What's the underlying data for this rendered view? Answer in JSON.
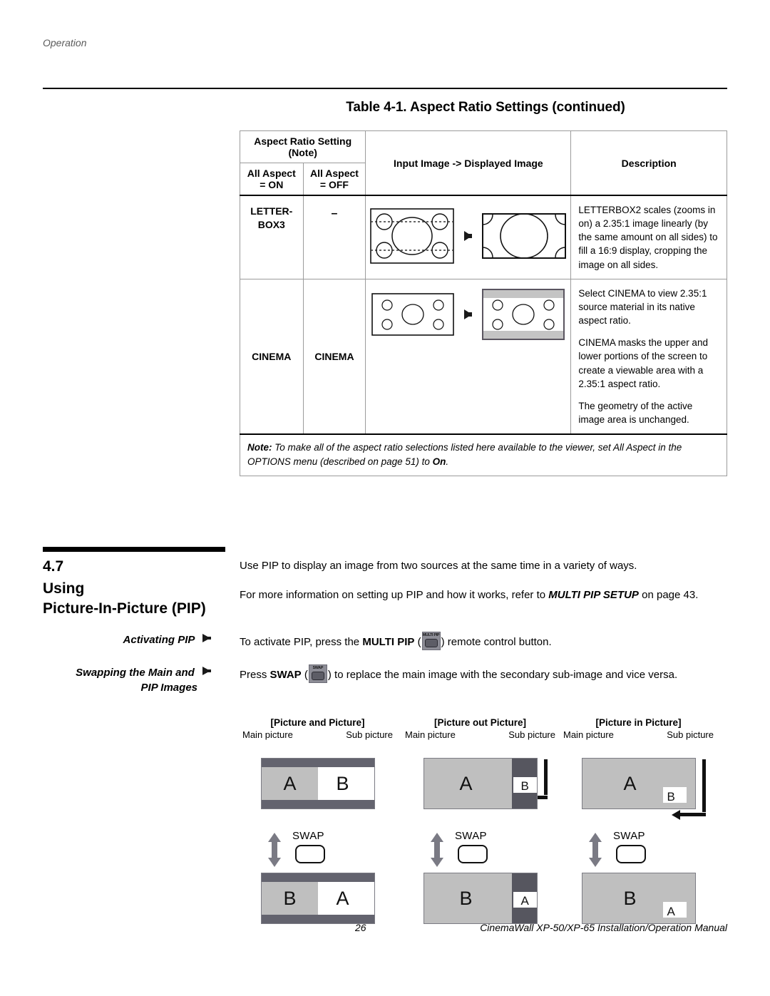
{
  "page": {
    "running_header": "Operation",
    "footer_page_number": "26",
    "footer_text": "CinemaWall XP-50/XP-65 Installation/Operation Manual"
  },
  "table": {
    "title": "Table 4-1. Aspect Ratio Settings (continued)",
    "headers": {
      "setting_group": "Aspect Ratio Setting",
      "setting_note": "(Note)",
      "all_aspect_on_line1": "All Aspect",
      "all_aspect_on_line2": "= ON",
      "all_aspect_off_line1": "All Aspect",
      "all_aspect_off_line2": "= OFF",
      "input_image": "Input Image -> Displayed Image",
      "description": "Description"
    },
    "rows": [
      {
        "on_label_line1": "LETTER-",
        "on_label_line2": "BOX3",
        "off_label": "–",
        "description": [
          "LETTERBOX2 scales (zooms in on) a 2.35:1 image linearly (by the same amount on all sides) to fill a 16:9 display, cropping the image on all sides."
        ]
      },
      {
        "on_label": "CINEMA",
        "off_label": "CINEMA",
        "description": [
          "Select CINEMA to view 2.35:1 source material in its native aspect ratio.",
          "CINEMA masks the upper and lower portions of the screen to create a viewable area with a 2.35:1 aspect ratio.",
          "The geometry of the active image area is unchanged."
        ]
      }
    ],
    "note": {
      "label": "Note:",
      "text_part1": " To make all of the aspect ratio selections listed here available to the viewer, set All Aspect in the OPTIONS menu (described on page 51) to ",
      "bold_end": "On",
      "period": "."
    }
  },
  "section": {
    "number": "4.7",
    "title_line1": "Using",
    "title_line2": "Picture-In-Picture (PIP)",
    "paragraph1": "Use PIP to display an image from two sources at the same time in a variety of ways.",
    "paragraph2_a": "For more information on setting up PIP and how it works, refer to ",
    "paragraph2_bold": "MULTI PIP SETUP",
    "paragraph2_b": " on page 43."
  },
  "subsections": [
    {
      "label": "Activating PIP",
      "body_a": "To activate PIP, press the ",
      "body_bold": "MULTI PIP",
      "button_label": "MULTI PIP",
      "body_b": " remote control button.",
      "open_paren": "(",
      "close_paren": ")"
    },
    {
      "label_line1": "Swapping the Main and",
      "label_line2": "PIP Images",
      "body_a": "Press ",
      "body_bold": "SWAP",
      "button_label": "SWAP",
      "body_b": " to replace the main image with the secondary sub-image and vice versa.",
      "open_paren": "(",
      "close_paren": ")"
    }
  ],
  "pip_diagrams": {
    "swap_label": "SWAP",
    "columns": [
      {
        "title": "[Picture and Picture]",
        "caption_main": "Main picture",
        "caption_sub": "Sub picture",
        "top_main_letter": "A",
        "top_sub_letter": "B",
        "bottom_main_letter": "B",
        "bottom_sub_letter": "A"
      },
      {
        "title": "[Picture out Picture]",
        "caption_main": "Main picture",
        "caption_sub": "Sub picture",
        "top_main_letter": "A",
        "top_sub_letter": "B",
        "bottom_main_letter": "B",
        "bottom_sub_letter": "A"
      },
      {
        "title": "[Picture in Picture]",
        "caption_main": "Main picture",
        "caption_sub": "Sub picture",
        "top_main_letter": "A",
        "top_sub_letter": "B",
        "bottom_main_letter": "B",
        "bottom_sub_letter": "A"
      }
    ]
  },
  "colors": {
    "screen_gray": "#bfbfbf",
    "bar_dark": "#63636e",
    "sub_panel_dark": "#56565f",
    "arrow_gray": "#7a7a84",
    "remote_body": "#8d8d96",
    "remote_key": "#5d5d66"
  }
}
